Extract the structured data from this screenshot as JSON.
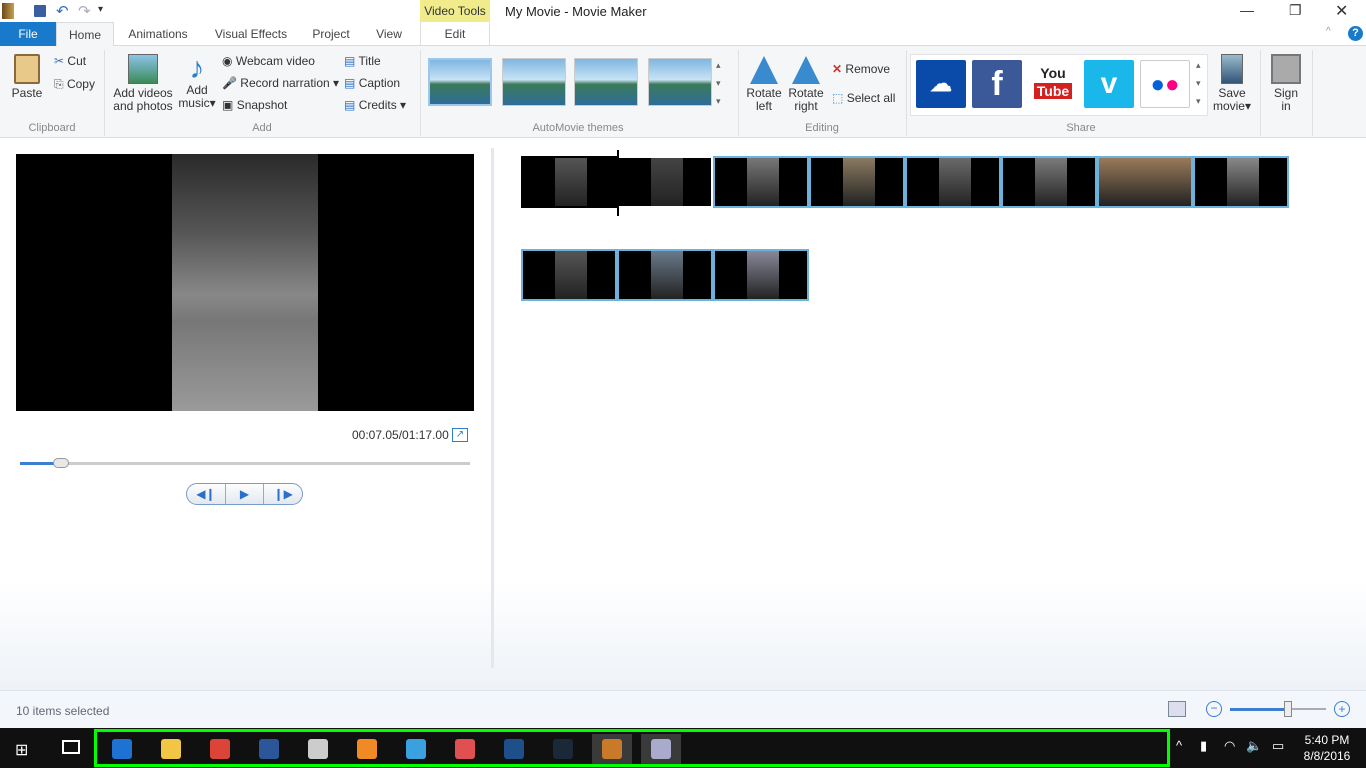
{
  "window": {
    "title": "My Movie - Movie Maker",
    "contextual_tab_group": "Video Tools"
  },
  "tabs": [
    {
      "label": "File"
    },
    {
      "label": "Home"
    },
    {
      "label": "Animations"
    },
    {
      "label": "Visual Effects"
    },
    {
      "label": "Project"
    },
    {
      "label": "View"
    },
    {
      "label": "Edit"
    }
  ],
  "ribbon": {
    "clipboard": {
      "label": "Clipboard",
      "paste": "Paste",
      "cut": "Cut",
      "copy": "Copy"
    },
    "add": {
      "label": "Add",
      "add_videos": "Add videos",
      "add_videos2": "and photos",
      "add_music": "Add",
      "add_music2": "music",
      "webcam": "Webcam video",
      "narration": "Record narration",
      "snapshot": "Snapshot",
      "title": "Title",
      "caption": "Caption",
      "credits": "Credits"
    },
    "themes": {
      "label": "AutoMovie themes"
    },
    "editing": {
      "label": "Editing",
      "rotate_left": "Rotate",
      "rotate_left2": "left",
      "rotate_right": "Rotate",
      "rotate_right2": "right",
      "remove": "Remove",
      "select_all": "Select all"
    },
    "share": {
      "label": "Share",
      "services": [
        "OneDrive",
        "Facebook",
        "YouTube",
        "Vimeo",
        "Flickr"
      ],
      "save_movie": "Save",
      "save_movie2": "movie"
    },
    "sign_in": {
      "label": "Sign",
      "label2": "in"
    }
  },
  "preview": {
    "time": "00:07.05/01:17.00",
    "progress": 0.092
  },
  "status": {
    "text": "10 items selected",
    "zoom": 0.6
  },
  "taskbar": {
    "apps": [
      "edge",
      "file-explorer",
      "chrome",
      "word",
      "app-wolf",
      "media-player",
      "control-panel",
      "snipping-tool",
      "visual-studio",
      "steam",
      "movie-maker",
      "screen-recorder"
    ],
    "time": "5:40 PM",
    "date": "8/8/2016"
  },
  "colors": {
    "accent": "#1979ca",
    "clip_border": "#6bb3dc",
    "highlight": "#00ff00"
  }
}
